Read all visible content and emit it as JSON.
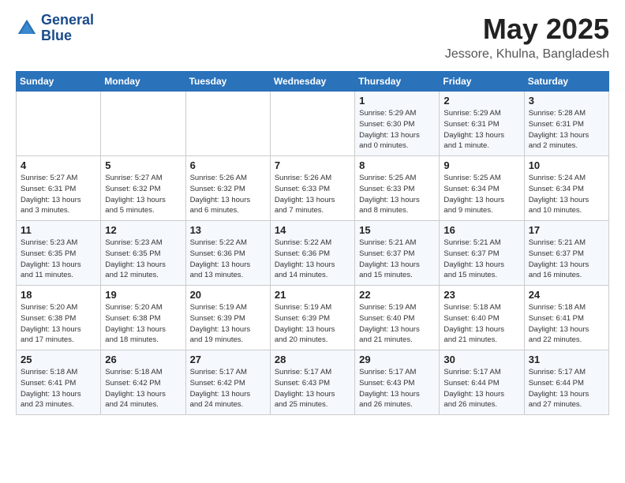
{
  "logo": {
    "line1": "General",
    "line2": "Blue"
  },
  "title": "May 2025",
  "location": "Jessore, Khulna, Bangladesh",
  "weekdays": [
    "Sunday",
    "Monday",
    "Tuesday",
    "Wednesday",
    "Thursday",
    "Friday",
    "Saturday"
  ],
  "weeks": [
    [
      {
        "day": "",
        "info": ""
      },
      {
        "day": "",
        "info": ""
      },
      {
        "day": "",
        "info": ""
      },
      {
        "day": "",
        "info": ""
      },
      {
        "day": "1",
        "info": "Sunrise: 5:29 AM\nSunset: 6:30 PM\nDaylight: 13 hours\nand 0 minutes."
      },
      {
        "day": "2",
        "info": "Sunrise: 5:29 AM\nSunset: 6:31 PM\nDaylight: 13 hours\nand 1 minute."
      },
      {
        "day": "3",
        "info": "Sunrise: 5:28 AM\nSunset: 6:31 PM\nDaylight: 13 hours\nand 2 minutes."
      }
    ],
    [
      {
        "day": "4",
        "info": "Sunrise: 5:27 AM\nSunset: 6:31 PM\nDaylight: 13 hours\nand 3 minutes."
      },
      {
        "day": "5",
        "info": "Sunrise: 5:27 AM\nSunset: 6:32 PM\nDaylight: 13 hours\nand 5 minutes."
      },
      {
        "day": "6",
        "info": "Sunrise: 5:26 AM\nSunset: 6:32 PM\nDaylight: 13 hours\nand 6 minutes."
      },
      {
        "day": "7",
        "info": "Sunrise: 5:26 AM\nSunset: 6:33 PM\nDaylight: 13 hours\nand 7 minutes."
      },
      {
        "day": "8",
        "info": "Sunrise: 5:25 AM\nSunset: 6:33 PM\nDaylight: 13 hours\nand 8 minutes."
      },
      {
        "day": "9",
        "info": "Sunrise: 5:25 AM\nSunset: 6:34 PM\nDaylight: 13 hours\nand 9 minutes."
      },
      {
        "day": "10",
        "info": "Sunrise: 5:24 AM\nSunset: 6:34 PM\nDaylight: 13 hours\nand 10 minutes."
      }
    ],
    [
      {
        "day": "11",
        "info": "Sunrise: 5:23 AM\nSunset: 6:35 PM\nDaylight: 13 hours\nand 11 minutes."
      },
      {
        "day": "12",
        "info": "Sunrise: 5:23 AM\nSunset: 6:35 PM\nDaylight: 13 hours\nand 12 minutes."
      },
      {
        "day": "13",
        "info": "Sunrise: 5:22 AM\nSunset: 6:36 PM\nDaylight: 13 hours\nand 13 minutes."
      },
      {
        "day": "14",
        "info": "Sunrise: 5:22 AM\nSunset: 6:36 PM\nDaylight: 13 hours\nand 14 minutes."
      },
      {
        "day": "15",
        "info": "Sunrise: 5:21 AM\nSunset: 6:37 PM\nDaylight: 13 hours\nand 15 minutes."
      },
      {
        "day": "16",
        "info": "Sunrise: 5:21 AM\nSunset: 6:37 PM\nDaylight: 13 hours\nand 15 minutes."
      },
      {
        "day": "17",
        "info": "Sunrise: 5:21 AM\nSunset: 6:37 PM\nDaylight: 13 hours\nand 16 minutes."
      }
    ],
    [
      {
        "day": "18",
        "info": "Sunrise: 5:20 AM\nSunset: 6:38 PM\nDaylight: 13 hours\nand 17 minutes."
      },
      {
        "day": "19",
        "info": "Sunrise: 5:20 AM\nSunset: 6:38 PM\nDaylight: 13 hours\nand 18 minutes."
      },
      {
        "day": "20",
        "info": "Sunrise: 5:19 AM\nSunset: 6:39 PM\nDaylight: 13 hours\nand 19 minutes."
      },
      {
        "day": "21",
        "info": "Sunrise: 5:19 AM\nSunset: 6:39 PM\nDaylight: 13 hours\nand 20 minutes."
      },
      {
        "day": "22",
        "info": "Sunrise: 5:19 AM\nSunset: 6:40 PM\nDaylight: 13 hours\nand 21 minutes."
      },
      {
        "day": "23",
        "info": "Sunrise: 5:18 AM\nSunset: 6:40 PM\nDaylight: 13 hours\nand 21 minutes."
      },
      {
        "day": "24",
        "info": "Sunrise: 5:18 AM\nSunset: 6:41 PM\nDaylight: 13 hours\nand 22 minutes."
      }
    ],
    [
      {
        "day": "25",
        "info": "Sunrise: 5:18 AM\nSunset: 6:41 PM\nDaylight: 13 hours\nand 23 minutes."
      },
      {
        "day": "26",
        "info": "Sunrise: 5:18 AM\nSunset: 6:42 PM\nDaylight: 13 hours\nand 24 minutes."
      },
      {
        "day": "27",
        "info": "Sunrise: 5:17 AM\nSunset: 6:42 PM\nDaylight: 13 hours\nand 24 minutes."
      },
      {
        "day": "28",
        "info": "Sunrise: 5:17 AM\nSunset: 6:43 PM\nDaylight: 13 hours\nand 25 minutes."
      },
      {
        "day": "29",
        "info": "Sunrise: 5:17 AM\nSunset: 6:43 PM\nDaylight: 13 hours\nand 26 minutes."
      },
      {
        "day": "30",
        "info": "Sunrise: 5:17 AM\nSunset: 6:44 PM\nDaylight: 13 hours\nand 26 minutes."
      },
      {
        "day": "31",
        "info": "Sunrise: 5:17 AM\nSunset: 6:44 PM\nDaylight: 13 hours\nand 27 minutes."
      }
    ]
  ]
}
